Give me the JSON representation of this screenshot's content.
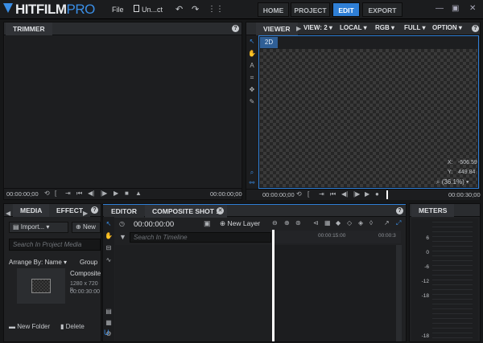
{
  "app": {
    "logo_main": "HITFILM",
    "logo_pro": "PRO"
  },
  "menu": {
    "file": "File",
    "project_name": "Un...ct"
  },
  "tabs": {
    "home": "HOME",
    "project": "PROJECT",
    "edit": "EDIT",
    "export": "EXPORT"
  },
  "window": {
    "minimize": "—",
    "restore": "▣",
    "close": "✕"
  },
  "trimmer": {
    "title": "TRIMMER",
    "start_tc": "00:00:00;00",
    "end_tc": "00:00:00;00",
    "help": "?"
  },
  "viewer": {
    "title": "VIEWER",
    "view_dd": "VIEW: 2",
    "space_dd": "LOCAL",
    "color_dd": "RGB",
    "quality_dd": "FULL",
    "option_dd": "OPTION",
    "mode_badge": "2D",
    "coord_x_label": "X:",
    "coord_x": "-506.59",
    "coord_y_label": "Y:",
    "coord_y": "449.84",
    "zoom": "(36.1%)",
    "start_tc": "00:00:00;00",
    "end_tc": "00:00:30;00",
    "help": "?"
  },
  "media": {
    "tab_media": "MEDIA",
    "tab_effects": "EFFECT",
    "import_label": "Import...",
    "new_label": "New",
    "search_placeholder": "Search In Project Media",
    "arrange_label": "Arrange By: Name",
    "group_label": "Group",
    "item_name": "Composite",
    "item_res": "1280 x 720 p",
    "item_dur": "00:00:30:00",
    "new_folder": "New Folder",
    "delete": "Delete",
    "help": "?"
  },
  "editor": {
    "tab_editor": "EDITOR",
    "tab_comp": "COMPOSITE SHOT 1",
    "timecode": "00:00:00:00",
    "new_layer": "New Layer",
    "search_placeholder": "Search In Timeline",
    "ruler_marks": [
      "00:00:15:00",
      "00:00:3"
    ],
    "help": "?"
  },
  "meters": {
    "title": "METERS",
    "scale": [
      "6",
      "0",
      "-6",
      "-12",
      "-18",
      "-18"
    ]
  },
  "colors": {
    "accent": "#2f7fd6",
    "panel": "#202123",
    "header": "#2a2c2f",
    "playhead": "#ffffff"
  }
}
